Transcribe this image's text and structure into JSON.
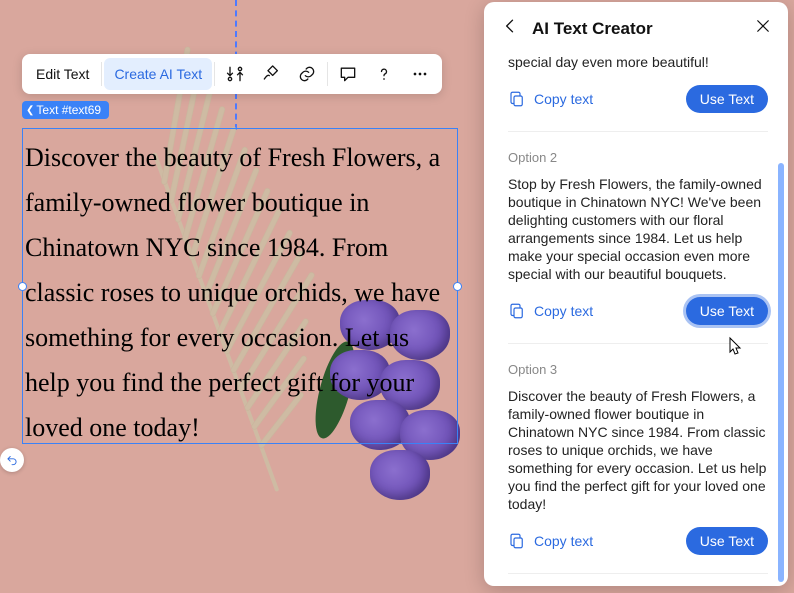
{
  "toolbar": {
    "edit_text": "Edit Text",
    "create_ai_text": "Create AI Text"
  },
  "element_tag": "Text #text69",
  "canvas_text": "Discover the beauty of Fresh Flowers, a family-owned flower boutique in Chinatown NYC since 1984. From classic roses to unique orchids, we have something for every occasion. Let us help you find the perfect gift for your loved one today!",
  "ai_panel": {
    "title": "AI Text Creator",
    "copy_label": "Copy text",
    "use_label": "Use Text",
    "partial_top_text": "special day even more beautiful!",
    "options": [
      {
        "label": "Option 2",
        "text": "Stop by Fresh Flowers, the family-owned boutique in Chinatown NYC! We've been delighting customers with our floral arrangements since 1984. Let us help make your special occasion even more special with our beautiful bouquets."
      },
      {
        "label": "Option 3",
        "text": "Discover the beauty of Fresh Flowers, a family-owned flower boutique in Chinatown NYC since 1984. From classic roses to unique orchids, we have something for every occasion. Let us help you find the perfect gift for your loved one today!"
      }
    ]
  }
}
